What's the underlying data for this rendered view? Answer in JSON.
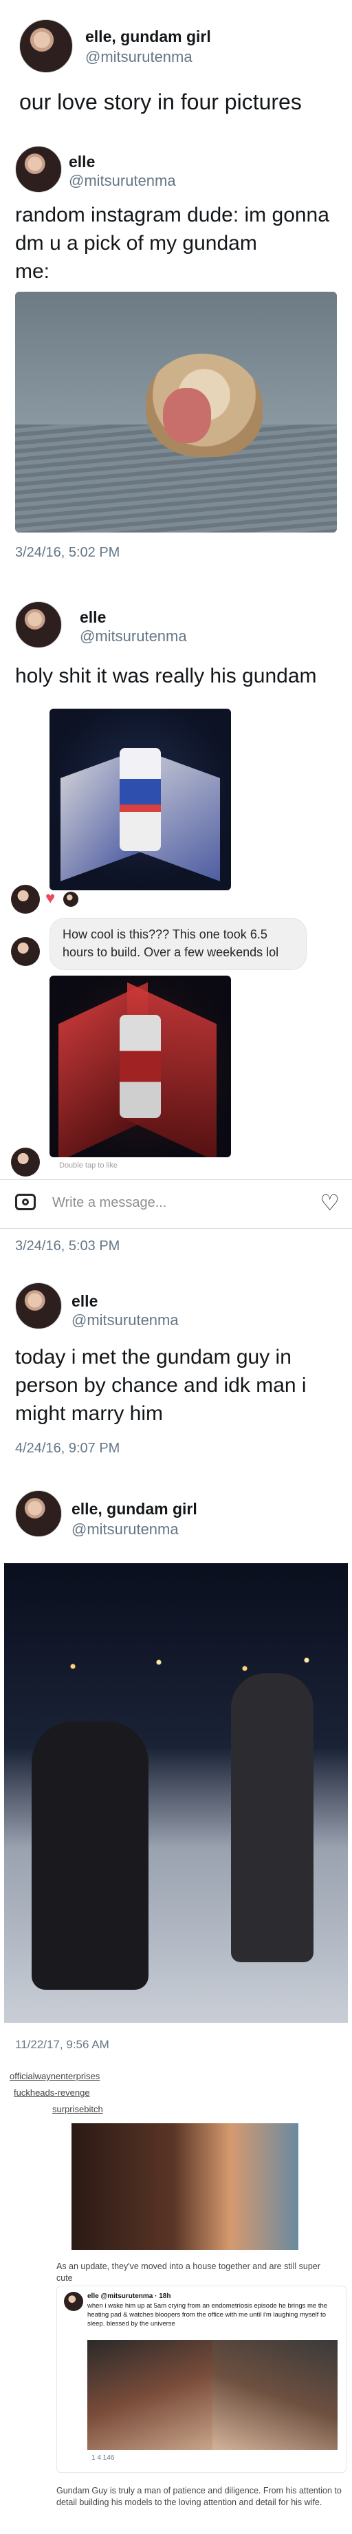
{
  "tweet1": {
    "name": "elle, gundam girl",
    "handle": "@mitsurutenma",
    "text": "our love story in four pictures"
  },
  "tweet2": {
    "name": "elle",
    "handle": "@mitsurutenma",
    "text": "random instagram dude: im gonna dm u a pick of my gundam",
    "me_label": "me:",
    "timestamp": "3/24/16, 5:02 PM"
  },
  "tweet3": {
    "name": "elle",
    "handle": "@mitsurutenma",
    "text": "holy shit it was really his gundam",
    "dm_message": "How cool is this??? This one took 6.5 hours to build. Over a few weekends lol",
    "seen_label": "Double tap to like",
    "composer_placeholder": "Write a message...",
    "timestamp": "3/24/16, 5:03 PM"
  },
  "tweet4": {
    "name": "elle",
    "handle": "@mitsurutenma",
    "text": "today i met the gundam guy in person by chance and idk man i might marry him",
    "timestamp": "4/24/16, 9:07 PM"
  },
  "tweet5": {
    "name": "elle, gundam girl",
    "handle": "@mitsurutenma",
    "timestamp": "11/22/17, 9:56 AM"
  },
  "tumblr": {
    "user1": "officialwaynenterprises",
    "user2": "fuckheads-revenge",
    "user3": "surprisebitch",
    "update_caption": "As an update, they've moved into a house together and are still super cute",
    "embedded_tweet": {
      "name": "elle @mitsurutenma · 18h",
      "text": "when i wake him up at 5am crying from an endometriosis episode he brings me the heating pad & watches bloopers from the office with me until i'm laughing myself to sleep. blessed by the universe",
      "actions": "1   4   146"
    },
    "closing_caption": "Gundam Guy is truly a man of patience and diligence. From his attention to detail building his models to the loving attention and detail for his wife."
  }
}
